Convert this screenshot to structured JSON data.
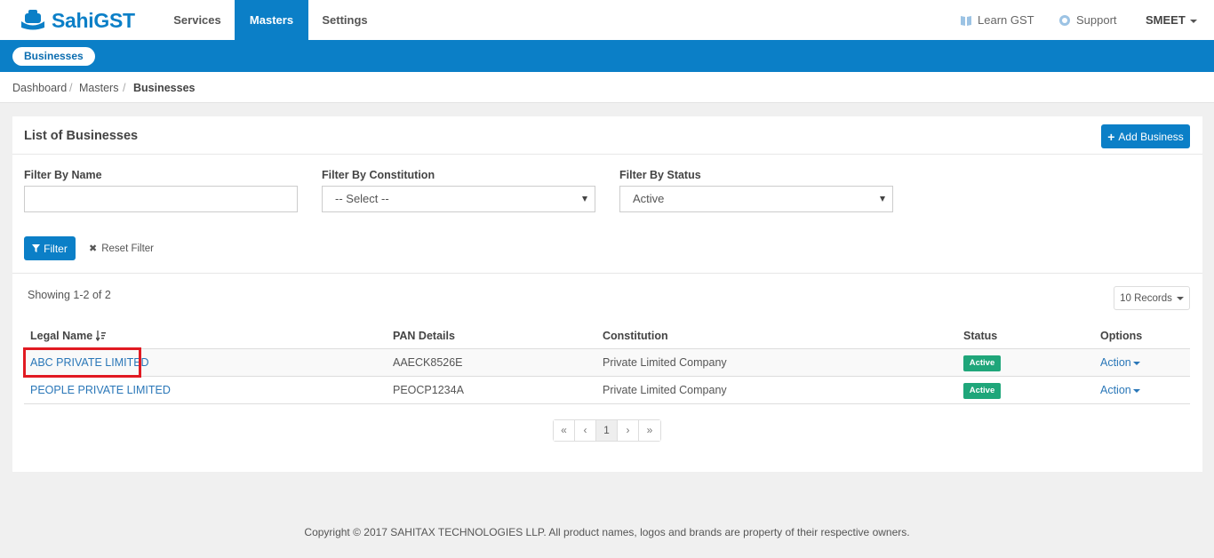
{
  "brand": {
    "name": "SahiGST"
  },
  "nav": {
    "items": [
      {
        "label": "Services"
      },
      {
        "label": "Masters"
      },
      {
        "label": "Settings"
      }
    ],
    "learn_gst": "Learn GST",
    "support": "Support",
    "user": "SMEET"
  },
  "subnav": {
    "active_pill": "Businesses"
  },
  "breadcrumb": {
    "items": [
      "Dashboard",
      "Masters",
      "Businesses"
    ]
  },
  "panel": {
    "title": "List of Businesses",
    "add_button": "Add Business"
  },
  "filters": {
    "name_label": "Filter By Name",
    "name_value": "",
    "constitution_label": "Filter By Constitution",
    "constitution_value": "-- Select --",
    "status_label": "Filter By Status",
    "status_value": "Active",
    "filter_button": "Filter",
    "reset_button": "Reset Filter"
  },
  "table": {
    "showing": "Showing 1-2 of 2",
    "records": "10 Records",
    "headers": [
      "Legal Name",
      "PAN Details",
      "Constitution",
      "Status",
      "Options"
    ],
    "rows": [
      {
        "name": "ABC PRIVATE LIMITED",
        "pan": "AAECK8526E",
        "constitution": "Private Limited Company",
        "status": "Active",
        "action": "Action"
      },
      {
        "name": "PEOPLE PRIVATE LIMITED",
        "pan": "PEOCP1234A",
        "constitution": "Private Limited Company",
        "status": "Active",
        "action": "Action"
      }
    ]
  },
  "pagination": {
    "first": "«",
    "prev": "‹",
    "current": "1",
    "next": "›",
    "last": "»"
  },
  "footer": {
    "text": "Copyright © 2017 SAHITAX TECHNOLOGIES LLP. All product names, logos and brands are property of their respective owners."
  },
  "colors": {
    "primary": "#0b7fc7",
    "status_active": "#1fa67a",
    "highlight": "#e11a22"
  }
}
